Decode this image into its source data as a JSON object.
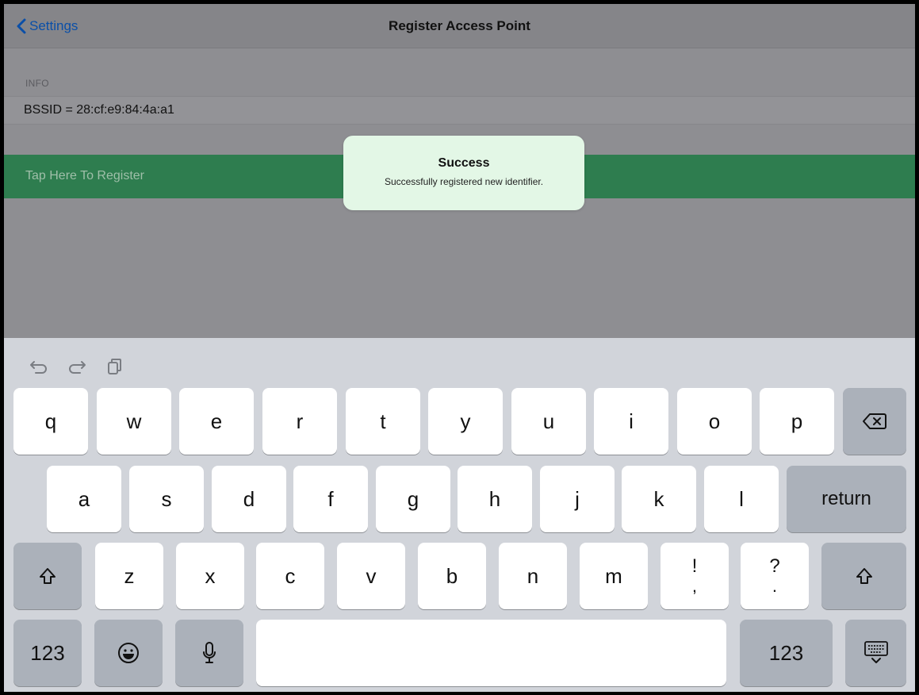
{
  "nav": {
    "back_label": "Settings",
    "title": "Register Access Point"
  },
  "table": {
    "section_header": "INFO",
    "info_row": "BSSID = 28:cf:e9:84:4a:a1",
    "register_row": "Tap Here To Register"
  },
  "toast": {
    "title": "Success",
    "message": "Successfully registered new identifier."
  },
  "keyboard": {
    "row1": [
      "q",
      "w",
      "e",
      "r",
      "t",
      "y",
      "u",
      "i",
      "o",
      "p"
    ],
    "row2": [
      "a",
      "s",
      "d",
      "f",
      "g",
      "h",
      "j",
      "k",
      "l"
    ],
    "return_label": "return",
    "row3": [
      "z",
      "x",
      "c",
      "v",
      "b",
      "n",
      "m"
    ],
    "punct1": {
      "top": "!",
      "bottom": ","
    },
    "punct2": {
      "top": "?",
      "bottom": "."
    },
    "numbers_label": "123"
  },
  "colors": {
    "accent": "#0a4fa8",
    "register_bg": "#2e7d4f",
    "toast_bg": "#e3f7e6",
    "keyboard_bg": "#d1d4da"
  }
}
